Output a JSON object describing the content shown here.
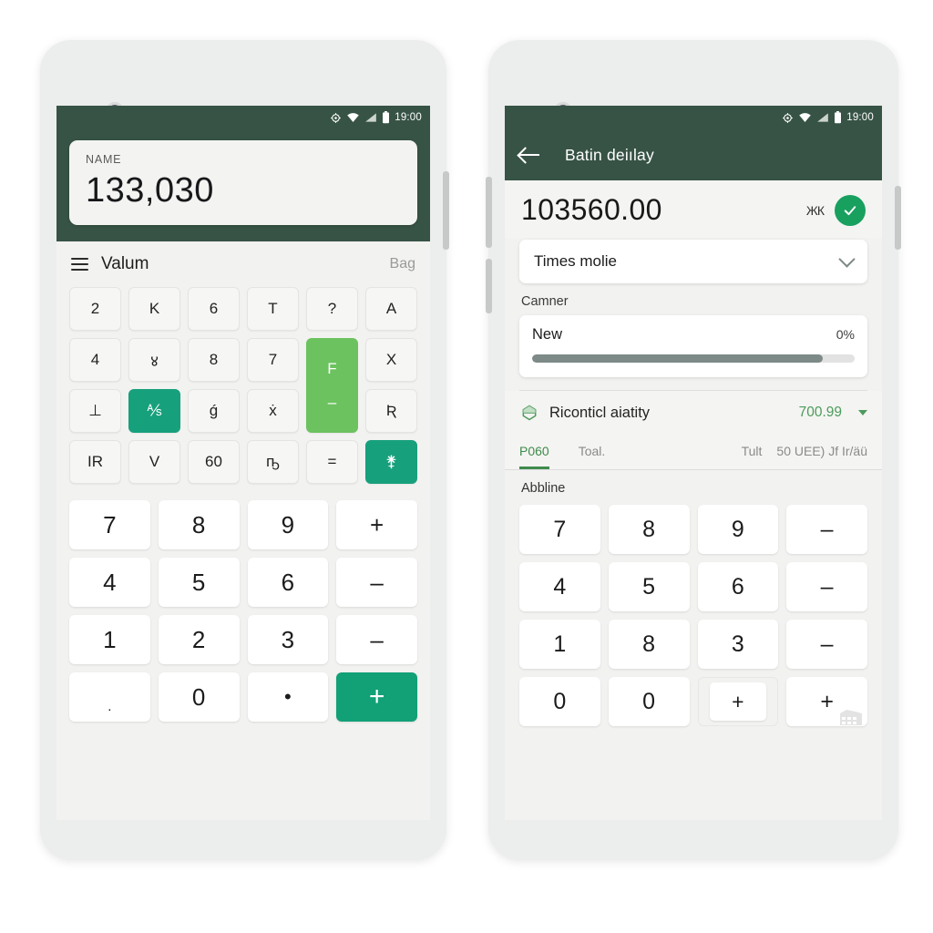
{
  "status_bar": {
    "time": "19:00",
    "icons": [
      "location-icon",
      "wifi-icon",
      "signal-icon",
      "battery-icon"
    ]
  },
  "left_phone": {
    "header": {
      "amount_label": "NAME",
      "amount_value": "133,030"
    },
    "toolbar": {
      "menu_icon": "hamburger-menu-icon",
      "title": "Valum",
      "right_label": "Bag"
    },
    "top_keys": [
      {
        "label": "2",
        "style": "plain"
      },
      {
        "label": "K",
        "style": "plain"
      },
      {
        "label": "6",
        "style": "plain"
      },
      {
        "label": "T",
        "style": "plain"
      },
      {
        "label": "?",
        "style": "plain"
      },
      {
        "label": "A",
        "style": "plain"
      },
      {
        "label": "4",
        "style": "plain"
      },
      {
        "label": "४",
        "style": "plain"
      },
      {
        "label": "8",
        "style": "plain"
      },
      {
        "label": "7",
        "style": "plain"
      },
      {
        "label": "F",
        "style": "green-tall",
        "label2": "–"
      },
      {
        "label": "X",
        "style": "plain"
      },
      {
        "label": "⊥",
        "style": "plain"
      },
      {
        "label": "⅍",
        "style": "teal"
      },
      {
        "label": "ǵ",
        "style": "plain"
      },
      {
        "label": "ẋ",
        "style": "plain"
      },
      {
        "label": "Ʀ",
        "style": "plain"
      },
      {
        "label": "IR",
        "style": "plain"
      },
      {
        "label": "V",
        "style": "plain"
      },
      {
        "label": "60",
        "style": "plain"
      },
      {
        "label": "ҧ",
        "style": "plain"
      },
      {
        "label": "=",
        "style": "plain"
      },
      {
        "label": "⚵",
        "style": "teal"
      }
    ],
    "numpad": [
      {
        "label": "7",
        "style": "plain"
      },
      {
        "label": "8",
        "style": "plain"
      },
      {
        "label": "9",
        "style": "plain"
      },
      {
        "label": "+",
        "style": "plain"
      },
      {
        "label": "4",
        "style": "plain"
      },
      {
        "label": "5",
        "style": "plain"
      },
      {
        "label": "6",
        "style": "plain"
      },
      {
        "label": "–",
        "style": "plain"
      },
      {
        "label": "1",
        "style": "plain"
      },
      {
        "label": "2",
        "style": "plain"
      },
      {
        "label": "3",
        "style": "plain"
      },
      {
        "label": "–",
        "style": "plain"
      },
      {
        "label": ".",
        "style": "small"
      },
      {
        "label": "0",
        "style": "plain"
      },
      {
        "label": "•",
        "style": "dot"
      },
      {
        "label": "+",
        "style": "accent"
      }
    ]
  },
  "right_phone": {
    "appbar": {
      "back_icon": "back-arrow-icon",
      "title": "Batin deiılay"
    },
    "amount": {
      "value": "103560.00",
      "unit": "ЖК",
      "confirm_icon": "check-circle-icon"
    },
    "select": {
      "value": "Times molie",
      "chevron_icon": "chevron-down-icon"
    },
    "section_label": "Camner",
    "progress": {
      "name": "New",
      "percent_label": "0%",
      "fill_ratio": 90
    },
    "recon": {
      "icon": "hexagon-icon",
      "label": "Riconticl aiatity",
      "value": "700.99",
      "caret_icon": "caret-down-icon"
    },
    "tabs": [
      {
        "label": "P060",
        "active": true
      },
      {
        "label": "Toal.",
        "active": false
      },
      {
        "label": "Tult",
        "active": false
      },
      {
        "label": "50 UEE) Jf Ir/äü",
        "active": false
      }
    ],
    "keypad_label": "Abbline",
    "numpad": [
      {
        "label": "7",
        "style": "plain"
      },
      {
        "label": "8",
        "style": "plain"
      },
      {
        "label": "9",
        "style": "plain"
      },
      {
        "label": "–",
        "style": "plain"
      },
      {
        "label": "4",
        "style": "plain"
      },
      {
        "label": "5",
        "style": "plain"
      },
      {
        "label": "6",
        "style": "plain"
      },
      {
        "label": "–",
        "style": "plain"
      },
      {
        "label": "1",
        "style": "plain"
      },
      {
        "label": "8",
        "style": "plain"
      },
      {
        "label": "3",
        "style": "plain"
      },
      {
        "label": "–",
        "style": "plain"
      },
      {
        "label": "0",
        "style": "plain"
      },
      {
        "label": "0",
        "style": "plain"
      },
      {
        "label": "+",
        "style": "nested"
      },
      {
        "label": "+",
        "style": "watermark"
      }
    ]
  },
  "colors": {
    "header_green": "#375345",
    "accent_teal": "#12a077",
    "accent_green": "#6cc25f",
    "tab_green": "#3f8b4c",
    "check_green": "#18a05f",
    "screen_bg": "#f2f2f0",
    "phone_body": "#eceded"
  }
}
